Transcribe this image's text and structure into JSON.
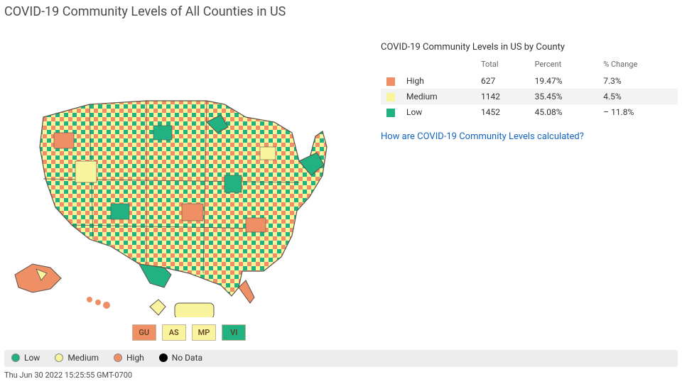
{
  "title": "COVID-19 Community Levels of All Counties in US",
  "colors": {
    "low": "#22b282",
    "medium": "#f8f59e",
    "high": "#ee8f66",
    "nodata": "#000000",
    "territory_border": "#c7b39a"
  },
  "territories": [
    {
      "code": "GU",
      "level": "high"
    },
    {
      "code": "AS",
      "level": "medium"
    },
    {
      "code": "MP",
      "level": "medium"
    },
    {
      "code": "VI",
      "level": "low"
    }
  ],
  "table": {
    "title": "COVID-19 Community Levels in US by County",
    "headers": {
      "total": "Total",
      "percent": "Percent",
      "change": "% Change"
    },
    "rows": [
      {
        "level": "high",
        "label": "High",
        "total": "627",
        "percent": "19.47%",
        "change": "7.3%"
      },
      {
        "level": "medium",
        "label": "Medium",
        "total": "1142",
        "percent": "35.45%",
        "change": "4.5%"
      },
      {
        "level": "low",
        "label": "Low",
        "total": "1452",
        "percent": "45.08%",
        "change": "– 11.8%"
      }
    ]
  },
  "calc_link": "How are COVID-19 Community Levels calculated?",
  "legend": [
    {
      "level": "low",
      "label": "Low"
    },
    {
      "level": "medium",
      "label": "Medium"
    },
    {
      "level": "high",
      "label": "High"
    },
    {
      "level": "nodata",
      "label": "No Data"
    }
  ],
  "timestamp": "Thu Jun 30 2022 15:25:55 GMT-0700"
}
